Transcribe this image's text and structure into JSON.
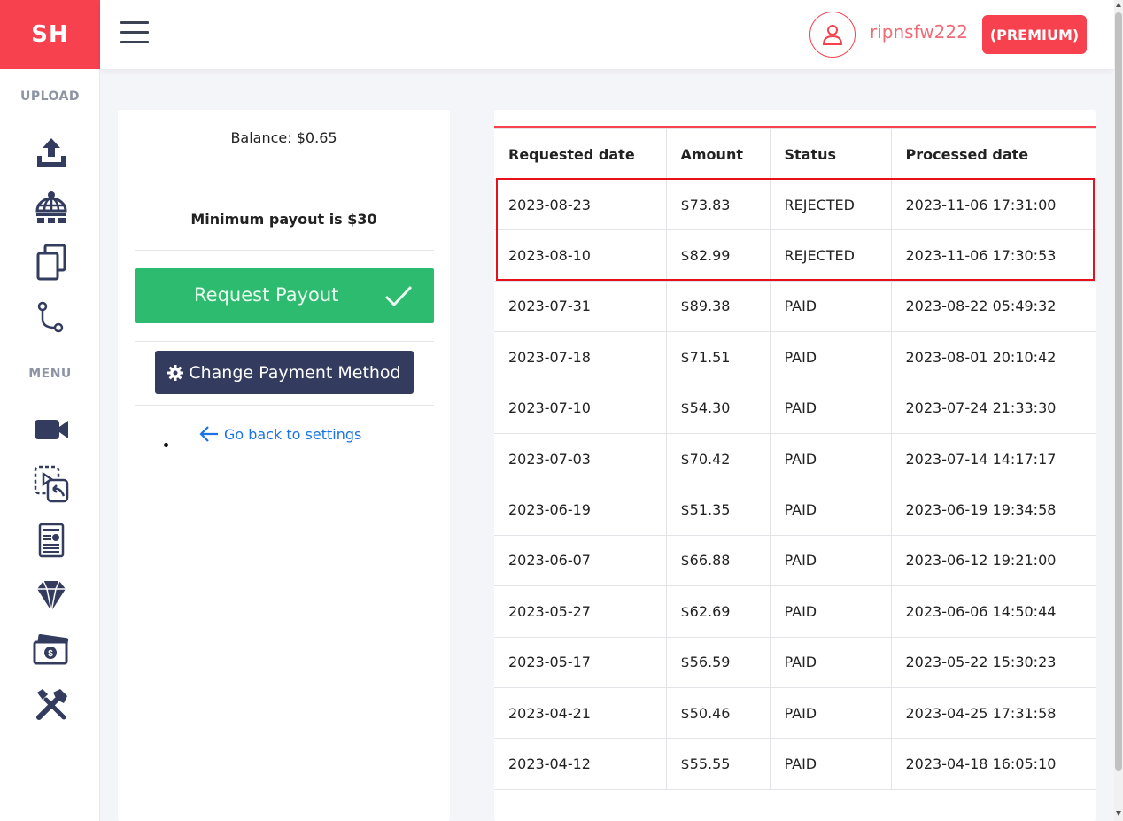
{
  "sidebar": {
    "logo": "SH",
    "upload_heading": "UPLOAD",
    "menu_heading": "MENU",
    "upload_icons": [
      "upload-icon",
      "globe-network-icon",
      "copy-files-icon",
      "git-branch-icon"
    ],
    "menu_icons": [
      "video-camera-icon",
      "video-reply-icon",
      "report-document-icon",
      "diamond-icon",
      "money-bill-icon",
      "tools-icon"
    ]
  },
  "header": {
    "username": "ripnsfw222",
    "badge": "(PREMIUM)"
  },
  "payout": {
    "balance": "Balance: $0.65",
    "minimum": "Minimum payout is $30",
    "request_label": "Request Payout",
    "change_method_label": "Change Payment Method",
    "back_label": "Go back to settings"
  },
  "table": {
    "headers": [
      "Requested date",
      "Amount",
      "Status",
      "Processed date"
    ],
    "rows": [
      [
        "2023-08-23",
        "$73.83",
        "REJECTED",
        "2023-11-06 17:31:00"
      ],
      [
        "2023-08-10",
        "$82.99",
        "REJECTED",
        "2023-11-06 17:30:53"
      ],
      [
        "2023-07-31",
        "$89.38",
        "PAID",
        "2023-08-22 05:49:32"
      ],
      [
        "2023-07-18",
        "$71.51",
        "PAID",
        "2023-08-01 20:10:42"
      ],
      [
        "2023-07-10",
        "$54.30",
        "PAID",
        "2023-07-24 21:33:30"
      ],
      [
        "2023-07-03",
        "$70.42",
        "PAID",
        "2023-07-14 14:17:17"
      ],
      [
        "2023-06-19",
        "$51.35",
        "PAID",
        "2023-06-19 19:34:58"
      ],
      [
        "2023-06-07",
        "$66.88",
        "PAID",
        "2023-06-12 19:21:00"
      ],
      [
        "2023-05-27",
        "$62.69",
        "PAID",
        "2023-06-06 14:50:44"
      ],
      [
        "2023-05-17",
        "$56.59",
        "PAID",
        "2023-05-22 15:30:23"
      ],
      [
        "2023-04-21",
        "$50.46",
        "PAID",
        "2023-04-25 17:31:58"
      ],
      [
        "2023-04-12",
        "$55.55",
        "PAID",
        "2023-04-18 16:05:10"
      ]
    ]
  },
  "colors": {
    "brand": "#f7414f",
    "success": "#2dbb6f",
    "navy": "#333c5e",
    "link": "#1a73e8",
    "highlight": "#e8101b"
  }
}
